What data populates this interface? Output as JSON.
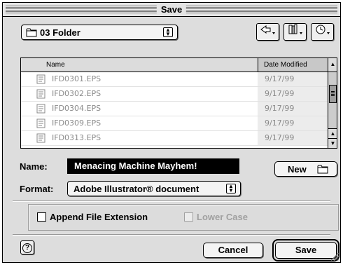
{
  "window": {
    "title": "Save"
  },
  "folder_popup": {
    "label": "03 Folder",
    "icon": "folder-icon"
  },
  "toolbar_buttons": [
    {
      "name": "shortcuts-button",
      "icon": "pointing-hand-icon"
    },
    {
      "name": "favorites-button",
      "icon": "books-icon"
    },
    {
      "name": "recent-button",
      "icon": "clock-icon"
    }
  ],
  "file_list": {
    "columns": {
      "name": "Name",
      "date": "Date Modified"
    },
    "rows": [
      {
        "name": "IFD0301.EPS",
        "date": "9/17/99"
      },
      {
        "name": "IFD0302.EPS",
        "date": "9/17/99"
      },
      {
        "name": "IFD0304.EPS",
        "date": "9/17/99"
      },
      {
        "name": "IFD0309.EPS",
        "date": "9/17/99"
      },
      {
        "name": "IFD0313.EPS",
        "date": "9/17/99"
      }
    ],
    "sort_indicator": "▲"
  },
  "name_field": {
    "label": "Name:",
    "value": "Menacing Machine Mayhem!"
  },
  "new_button": {
    "label": "New"
  },
  "format": {
    "label": "Format:",
    "value": "Adobe Illustrator® document"
  },
  "options": {
    "append_extension": {
      "label": "Append File Extension",
      "checked": false
    },
    "lower_case": {
      "label": "Lower Case",
      "checked": false,
      "enabled": false
    }
  },
  "help": {
    "label": "?"
  },
  "buttons": {
    "cancel": "Cancel",
    "save": "Save"
  }
}
